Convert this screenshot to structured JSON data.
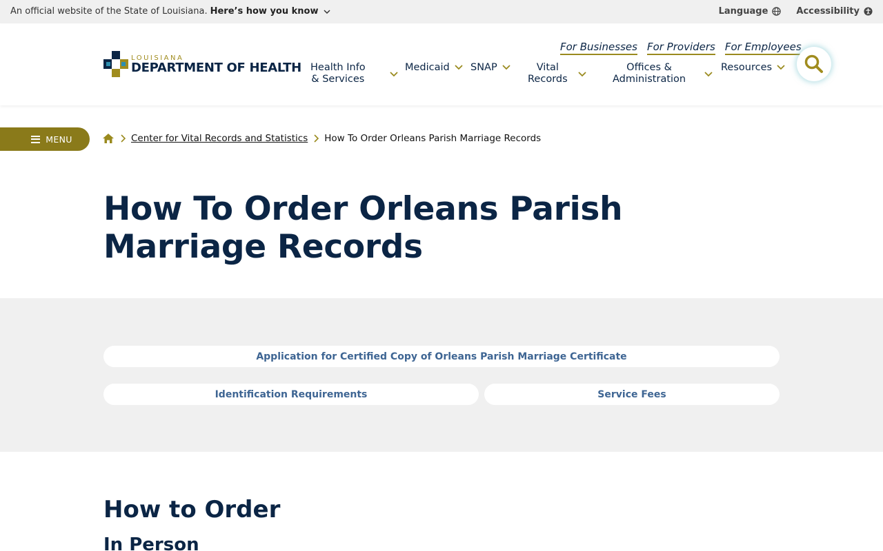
{
  "banner": {
    "official_text": "An official website of the State of Louisiana.",
    "how_text": "Here’s how you know",
    "language_label": "Language",
    "accessibility_label": "Accessibility"
  },
  "logo": {
    "small_text": "LOUISIANA",
    "big_text": "DEPARTMENT OF HEALTH"
  },
  "audience_links": [
    {
      "label": "For Businesses"
    },
    {
      "label": "For Providers"
    },
    {
      "label": "For Employees"
    }
  ],
  "nav": [
    {
      "line1": "Health Info",
      "line2": "& Services"
    },
    {
      "line1": "Medicaid",
      "line2": ""
    },
    {
      "line1": "SNAP",
      "line2": ""
    },
    {
      "line1": "Vital",
      "line2": "Records"
    },
    {
      "line1": "Offices &",
      "line2": "Administration"
    },
    {
      "line1": "Resources",
      "line2": ""
    }
  ],
  "menu_label": "MENU",
  "breadcrumb": {
    "parent": "Center for Vital Records and Statistics",
    "current": "How To Order Orleans Parish Marriage Records"
  },
  "page_title": "How To Order Orleans Parish Marriage Records",
  "quick_links": {
    "application": "Application for Certified Copy of Orleans Parish Marriage Certificate",
    "identification": "Identification Requirements",
    "fees": "Service Fees"
  },
  "section": {
    "heading": "How to Order",
    "subheading": "In Person"
  },
  "colors": {
    "navy": "#0b2545",
    "gold": "#8a7a1a",
    "link_blue": "#3e6593",
    "gray_bg": "#f0f0f0"
  }
}
